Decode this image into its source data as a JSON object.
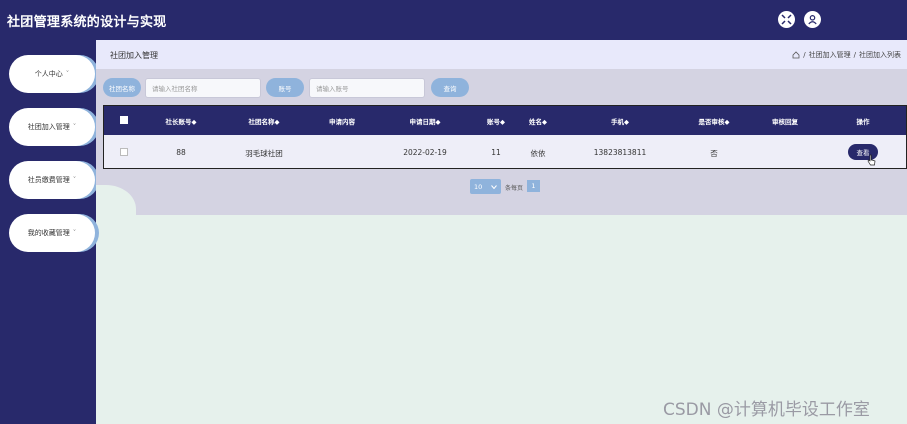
{
  "header": {
    "title": "社团管理系统的设计与实现",
    "icons": [
      "fullscreen-icon",
      "user-icon"
    ]
  },
  "sidebar": {
    "items": [
      {
        "label": "个人中心",
        "arrow": "˅"
      },
      {
        "label": "社团加入管理",
        "arrow": "˅"
      },
      {
        "label": "社员缴费管理",
        "arrow": "˅"
      },
      {
        "label": "我的收藏管理",
        "arrow": "˅"
      }
    ]
  },
  "breadcrumb": {
    "title": "社团加入管理",
    "home_icon": "home-icon",
    "sep": "/",
    "level1": "社团加入管理",
    "level2": "社团加入列表"
  },
  "search": {
    "club_label": "社团名称",
    "club_placeholder": "请输入社团名称",
    "account_label": "账号",
    "account_placeholder": "请输入账号",
    "query_label": "查询"
  },
  "table": {
    "headers": [
      "社长账号◆",
      "社团名称◆",
      "申请内容",
      "申请日期◆",
      "账号◆",
      "姓名◆",
      "手机◆",
      "是否审核◆",
      "审核回复",
      "操作"
    ],
    "rows": [
      {
        "leader": "88",
        "club": "羽毛球社团",
        "content": "",
        "date": "2022-02-19",
        "account": "11",
        "name": "依依",
        "phone": "13823813811",
        "audited": "否",
        "reply": "",
        "action": "查看"
      }
    ]
  },
  "pagination": {
    "page_size": "10",
    "per_page_suffix": "条每页",
    "current_page": "1"
  },
  "watermark": "CSDN @计算机毕设工作室",
  "colors": {
    "primary": "#28296b",
    "accent": "#8fb3dc",
    "header_bg": "#e8e9fb"
  }
}
